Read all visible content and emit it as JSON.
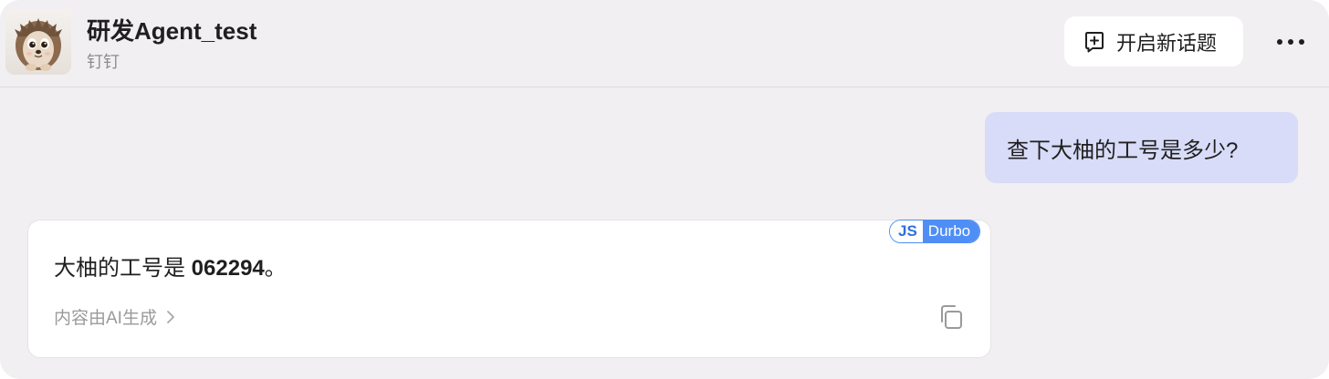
{
  "header": {
    "title": "研发Agent_test",
    "subtitle": "钉钉",
    "new_topic_label": "开启新话题",
    "avatar_icon": "hedgehog-avatar",
    "new_topic_icon": "plus-square-icon",
    "more_icon": "more-horizontal-icon"
  },
  "messages": {
    "user": {
      "text": "查下大柚的工号是多少?"
    },
    "bot": {
      "answer_prefix": "大柚的工号是 ",
      "answer_number": "062294",
      "answer_suffix": "。",
      "ai_note": "内容由AI生成",
      "badge_js": "JS",
      "badge_name": "Durbo",
      "copy_icon": "copy-icon",
      "chevron_icon": "chevron-right-icon"
    }
  },
  "colors": {
    "window_bg": "#f1eff1",
    "user_bubble": "#d8dcf8",
    "badge_blue": "#4f8ef5"
  }
}
